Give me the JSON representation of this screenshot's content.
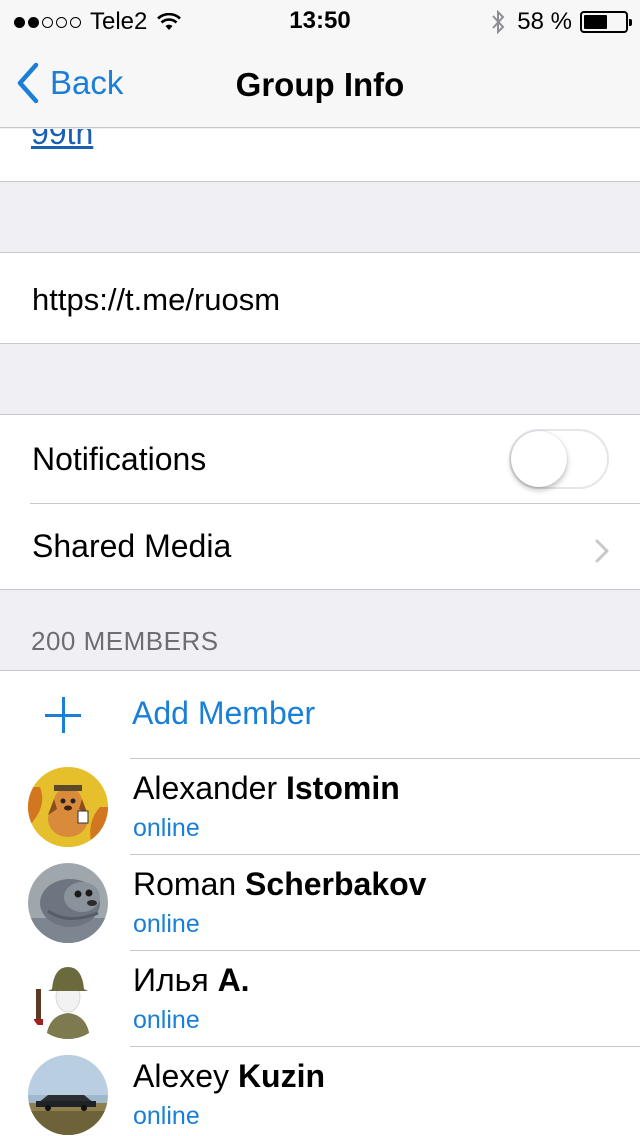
{
  "status_bar": {
    "carrier": "Tele2",
    "time": "13:50",
    "battery_text": "58 %",
    "battery_level": 0.58
  },
  "nav": {
    "back_label": "Back",
    "title": "Group Info"
  },
  "info": {
    "description_link": "99th",
    "invite_link": "https://t.me/ruosm"
  },
  "settings": {
    "notifications_label": "Notifications",
    "notifications_on": false,
    "shared_media_label": "Shared Media"
  },
  "members": {
    "header": "200 MEMBERS",
    "add_label": "Add Member",
    "list": [
      {
        "first": "Alexander",
        "last": "Istomin",
        "status": "online"
      },
      {
        "first": "Roman",
        "last": "Scherbakov",
        "status": "online"
      },
      {
        "first": "Илья",
        "last": "А.",
        "status": "online"
      },
      {
        "first": "Alexey",
        "last": "Kuzin",
        "status": "online"
      }
    ]
  },
  "colors": {
    "accent": "#1a7fd8",
    "link": "#1a5fb4",
    "separator": "#c8c7cc",
    "group_bg": "#efeff4"
  },
  "icons": [
    "wifi-icon",
    "bluetooth-icon",
    "battery-icon",
    "back-chevron-icon",
    "chevron-right-icon",
    "plus-icon"
  ]
}
